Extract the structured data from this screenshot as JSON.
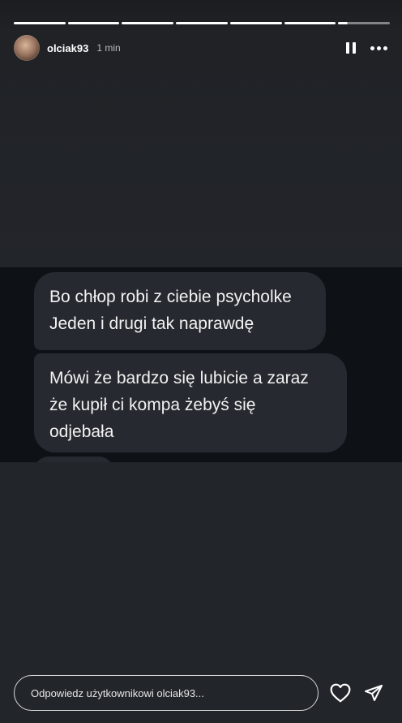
{
  "story": {
    "username": "olciak93",
    "time": "1 min",
    "progress_segments": 7,
    "current_segment_progress": 0.18
  },
  "screenshot": {
    "messages": [
      {
        "lines": [
          "Bo chłop robi z ciebie psycholke",
          "Jeden i drugi tak naprawdę"
        ]
      },
      {
        "lines": [
          "Mówi że bardzo się lubicie a zaraz",
          "że kupił ci kompa żebyś się",
          "odjebała"
        ]
      }
    ]
  },
  "footer": {
    "reply_placeholder": "Odpowiedz użytkownikowi olciak93..."
  },
  "icons": {
    "pause": "pause-icon",
    "more": "more-icon",
    "heart": "heart-icon",
    "send": "send-icon"
  }
}
